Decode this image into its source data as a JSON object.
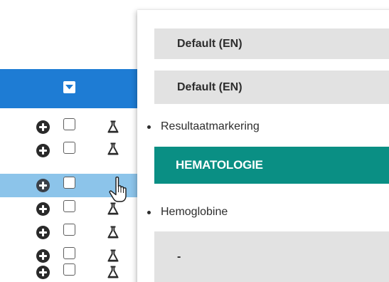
{
  "grid": {
    "header_color": "#1e7cd4",
    "row_count": 7,
    "selected_row_index": 3,
    "selected_row_color": "#8cc4ea"
  },
  "popup": {
    "sections": [
      {
        "type": "header",
        "label": "Default (EN)"
      },
      {
        "type": "header",
        "label": "Default (EN)"
      },
      {
        "type": "bullet",
        "label": "Resultaatmarkering"
      },
      {
        "type": "category",
        "label": "HEMATOLOGIE",
        "color": "#0a8f84"
      },
      {
        "type": "bullet",
        "label": "Hemoglobine"
      },
      {
        "type": "header",
        "label": "-"
      }
    ]
  },
  "icons": {
    "expand": "plus-circle-icon",
    "row_type": "flask-icon",
    "column_menu": "chevron-down-icon",
    "cursor": "hand-pointer-icon"
  }
}
